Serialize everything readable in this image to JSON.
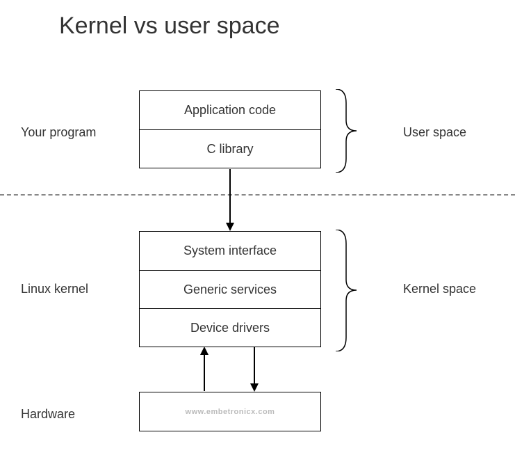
{
  "title": "Kernel vs user space",
  "left_labels": {
    "program": "Your program",
    "kernel": "Linux kernel",
    "hardware": "Hardware"
  },
  "right_labels": {
    "user_space": "User space",
    "kernel_space": "Kernel space"
  },
  "user_stack": {
    "app_code": "Application code",
    "c_library": "C library"
  },
  "kernel_stack": {
    "sys_interface": "System interface",
    "generic_services": "Generic services",
    "device_drivers": "Device drivers"
  },
  "hw_box": "www.embetronicx.com"
}
